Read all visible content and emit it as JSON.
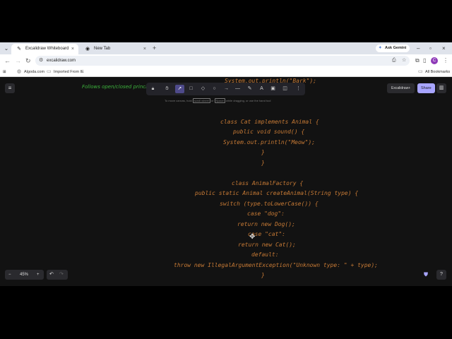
{
  "browser": {
    "tabs": [
      {
        "label": "Excalidraw Whiteboard",
        "active": true,
        "favicon": "excalidraw-icon"
      },
      {
        "label": "New Tab",
        "active": false,
        "favicon": "chrome-icon"
      }
    ],
    "new_tab": "+",
    "gemini_label": "Ask Gemini",
    "url": "excalidraw.com",
    "profile_initial": "C",
    "bookmarks": [
      {
        "label": "Algoda.com",
        "icon": "globe-icon"
      },
      {
        "label": "Imported From IE",
        "icon": "folder-icon"
      }
    ],
    "all_bookmarks": "All Bookmarks"
  },
  "canvas": {
    "green_note": "Follows open/closed princi",
    "hint": "To move canvas, hold [scroll wheel] or [Space] while dragging, or use the hand tool",
    "hint_prefix": "To move canvas, hold",
    "hint_key1": "scroll wheel",
    "hint_or": "or",
    "hint_key2": "Space",
    "hint_suffix": "while dragging, or use the hand tool",
    "code_lines": [
      "System.out.println(\"Bark\");",
      "class Cat implements Animal {",
      "public void sound() {",
      "System.out.println(\"Meow\");",
      "}",
      "}",
      "class AnimalFactory {",
      "public static Animal createAnimal(String type) {",
      "switch (type.toLowerCase()) {",
      "case \"dog\":",
      "return new Dog();",
      "case \"cat\":",
      "return new Cat();",
      "default:",
      "throw new IllegalArgumentException(\"Unknown type: \" + type);",
      "}"
    ]
  },
  "ui": {
    "plus_label": "Excalidraw+",
    "share_label": "Share",
    "zoom_level": "45%",
    "zoom_out": "−",
    "zoom_in": "+",
    "code_color": "#c77a35",
    "note_color": "#3db33d",
    "accent": "#a8a5ff"
  }
}
